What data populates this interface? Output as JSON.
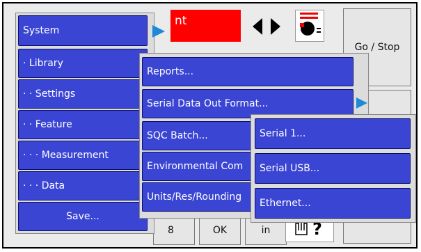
{
  "status": {
    "text": "nt",
    "color": "#ff0000"
  },
  "colors": {
    "menu_bg": "#3a45d4",
    "arrow": "#1d8ad6"
  },
  "icons": {
    "nav": "left-right-arrows-icon",
    "indicator": "red-black-indicator-icon",
    "touch": "hand-pointer-question-icon"
  },
  "right_panel": {
    "go_stop": "Go / Stop"
  },
  "bottom_bar": {
    "num": "8",
    "ok": "OK",
    "unit": "in"
  },
  "menu_level1": {
    "system": "System",
    "library": "· Library",
    "settings": "· · Settings",
    "feature": "· · Feature",
    "measurement": "· · · Measurement",
    "data": "· · · Data",
    "save": "Save..."
  },
  "menu_level2": {
    "reports": "Reports...",
    "serial_out": "Serial Data Out Format...",
    "sqc": "SQC Batch...",
    "environmental": "Environmental Com",
    "units": "Units/Res/Rounding"
  },
  "menu_level3": {
    "serial1": "Serial 1...",
    "serial_usb": "Serial USB...",
    "ethernet": "Ethernet..."
  }
}
